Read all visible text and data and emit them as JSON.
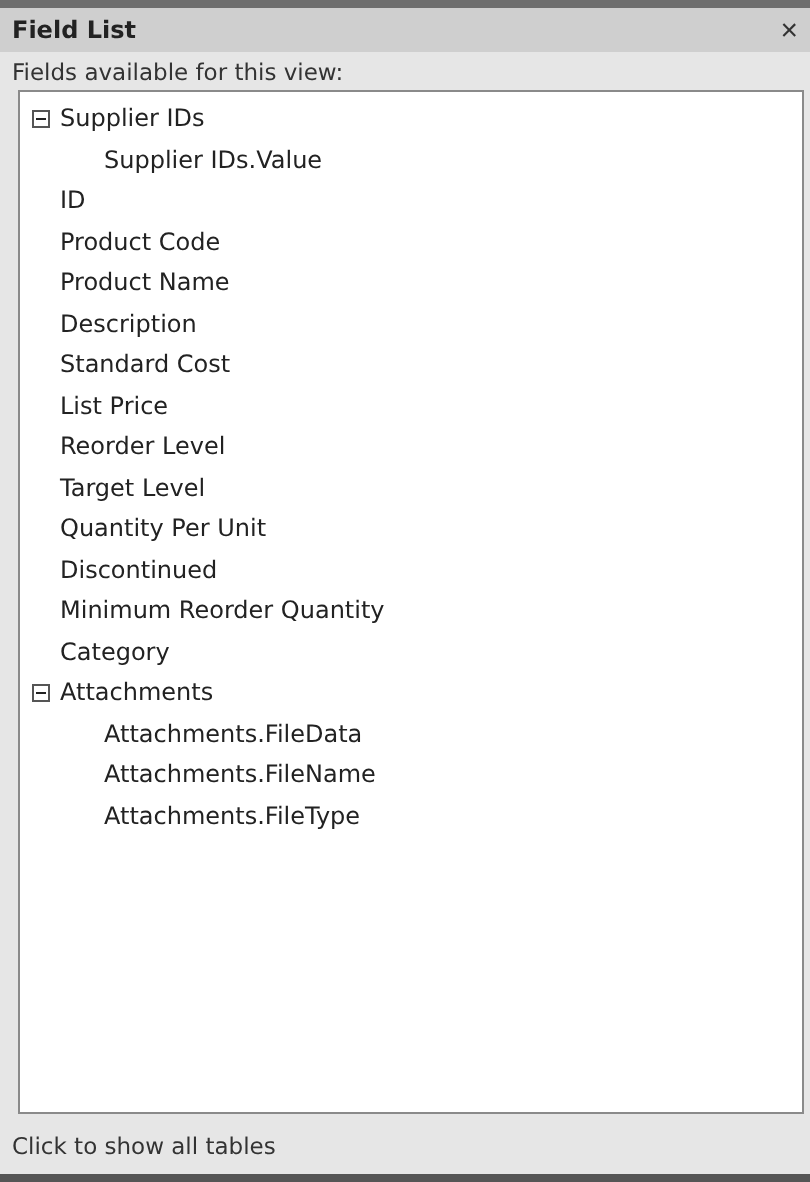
{
  "title": "Field List",
  "close": "×",
  "caption": "Fields available for this view:",
  "fields": [
    {
      "label": "Supplier IDs",
      "expanded": true,
      "children": [
        {
          "label": "Supplier IDs.Value"
        }
      ]
    },
    {
      "label": "ID"
    },
    {
      "label": "Product Code"
    },
    {
      "label": "Product Name"
    },
    {
      "label": "Description"
    },
    {
      "label": "Standard Cost"
    },
    {
      "label": "List Price"
    },
    {
      "label": "Reorder Level"
    },
    {
      "label": "Target Level"
    },
    {
      "label": "Quantity Per Unit"
    },
    {
      "label": "Discontinued"
    },
    {
      "label": "Minimum Reorder Quantity"
    },
    {
      "label": "Category"
    },
    {
      "label": "Attachments",
      "expanded": true,
      "children": [
        {
          "label": "Attachments.FileData"
        },
        {
          "label": "Attachments.FileName"
        },
        {
          "label": "Attachments.FileType"
        }
      ]
    }
  ],
  "footer_link": "Click to show all tables"
}
